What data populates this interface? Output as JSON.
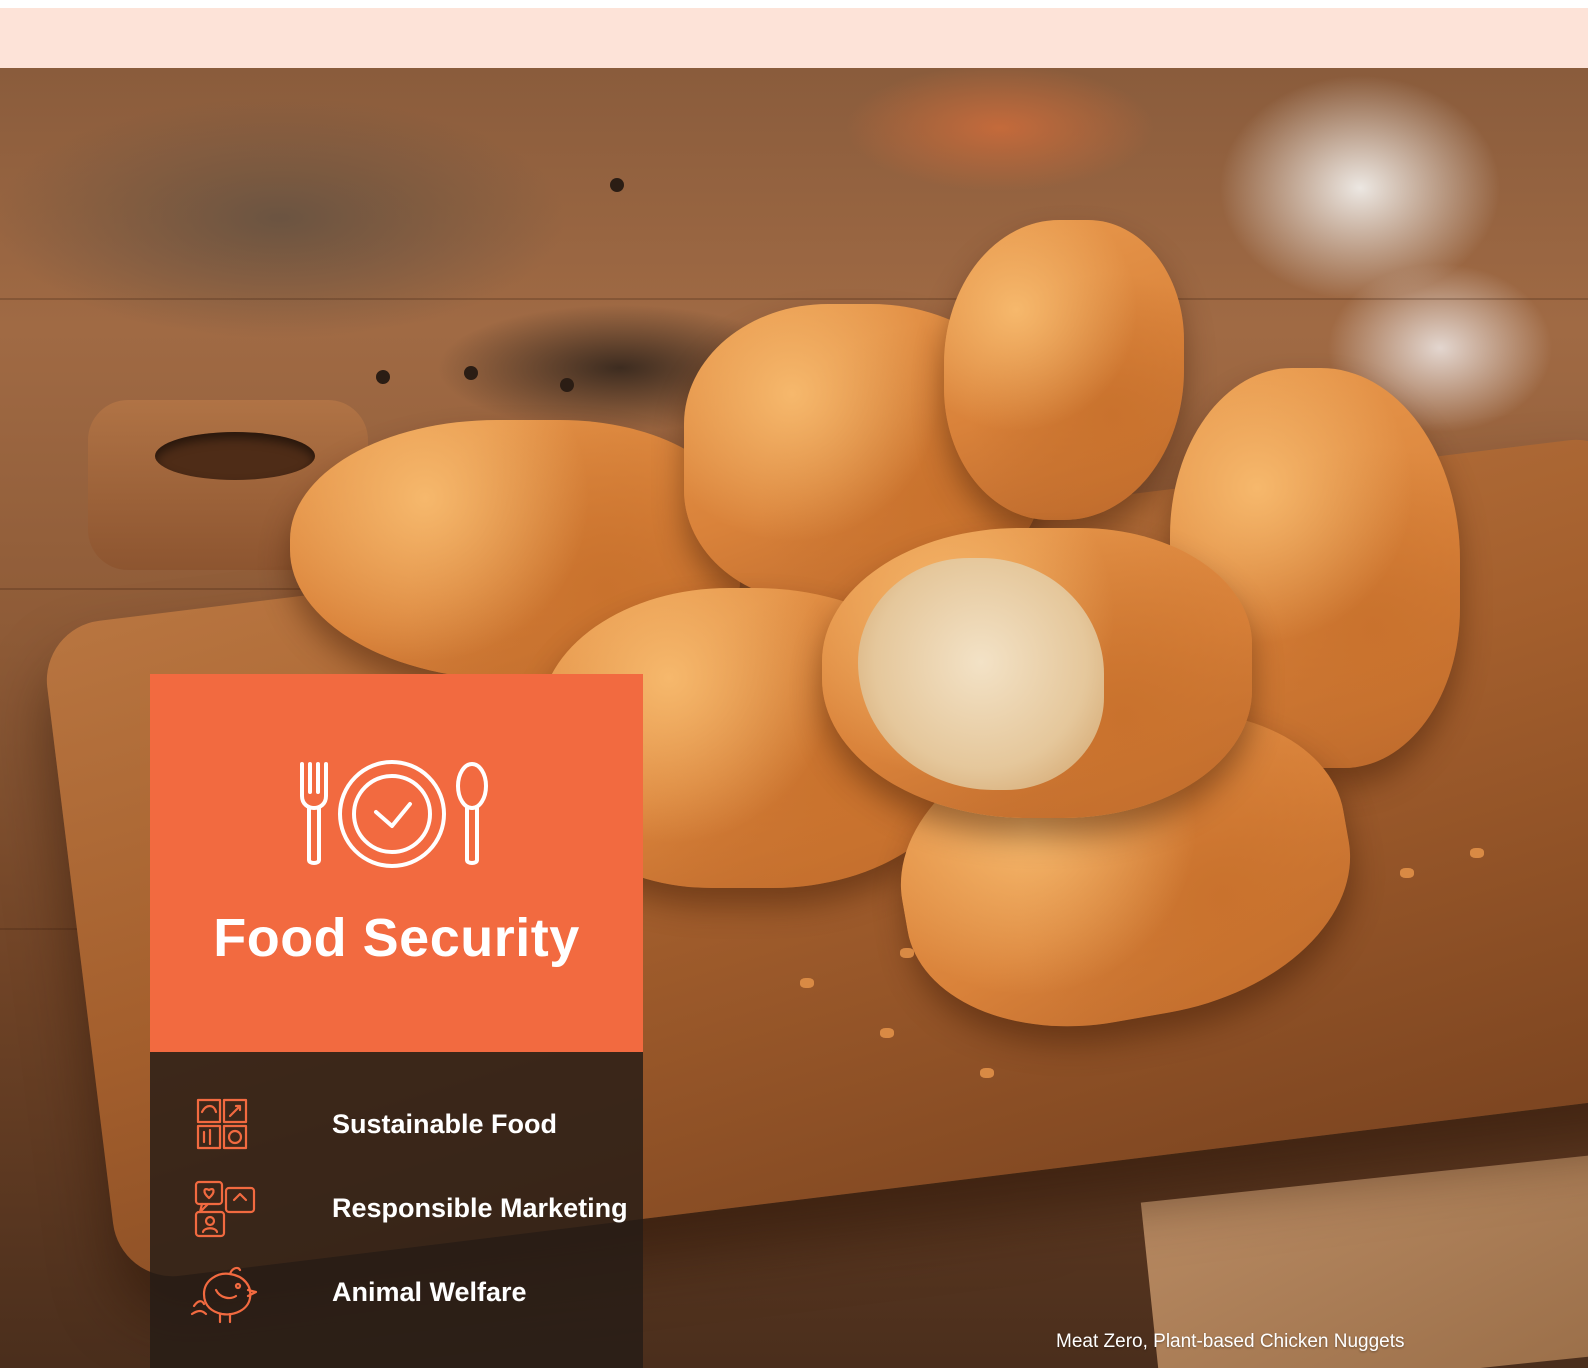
{
  "panel": {
    "title": "Food Security",
    "icon": "fork-plate-spoon-icon",
    "accent_color": "#f26a40"
  },
  "topics": [
    {
      "label": "Sustainable Food",
      "icon": "sustainable-food-icon"
    },
    {
      "label": "Responsible Marketing",
      "icon": "responsible-marketing-icon"
    },
    {
      "label": "Animal Welfare",
      "icon": "animal-welfare-icon"
    }
  ],
  "photo": {
    "caption": "Meat Zero, Plant-based Chicken Nuggets"
  }
}
